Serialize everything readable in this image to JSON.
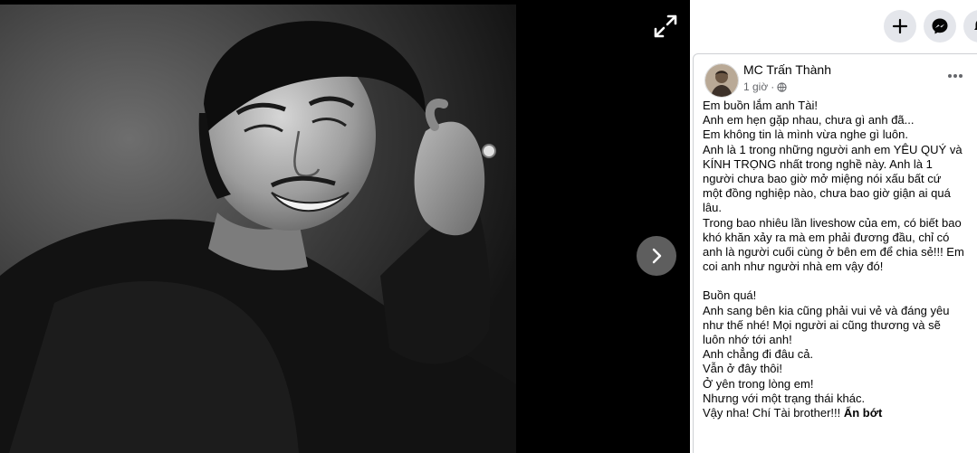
{
  "post": {
    "author": "MC Trấn Thành",
    "time": "1 giờ",
    "separator": "·",
    "privacy_icon": "globe-icon",
    "more_icon": "ellipsis-icon",
    "lines": [
      "Em buồn lắm anh Tài!",
      "Anh em hẹn gặp nhau, chưa gì anh đã...",
      "Em không tin là mình vừa nghe gì luôn.",
      "Anh là 1 trong những người anh em YÊU QUÝ và",
      "KÍNH TRỌNG nhất trong nghề này. Anh là 1",
      "người chưa bao giờ mở miệng nói xấu bất cứ",
      "một đồng nghiệp nào, chưa bao giờ giận ai quá",
      "lâu.",
      "Trong bao nhiêu lần liveshow của em, có biết bao",
      "khó khăn xảy ra mà em phải đương đầu, chỉ có",
      "anh là người cuối cùng ở bên em để chia sẻ!!! Em",
      "coi anh như người nhà em vậy đó!",
      "",
      "Buồn quá!",
      "Anh sang bên kia cũng phải vui vẻ và đáng yêu",
      "như thế nhé! Mọi người ai cũng thương và sẽ",
      "luôn nhớ tới anh!",
      "Anh chẳng đi đâu cả.",
      "Vẫn ở đây thôi!",
      "Ở yên trong lòng em!",
      "Nhưng với một trạng thái khác.",
      "Vậy nha! Chí Tài brother!!!"
    ],
    "see_less": "Ẩn bớt"
  },
  "topbar": {
    "icons": [
      "plus-icon",
      "messenger-icon",
      "bell-icon"
    ]
  },
  "viewer": {
    "expand_icon": "expand-icon",
    "next_icon": "chevron-right-icon"
  },
  "colors": {
    "panel_bg": "#ffffff",
    "button_bg": "#e4e6eb",
    "text": "#050505",
    "meta": "#65676b"
  }
}
